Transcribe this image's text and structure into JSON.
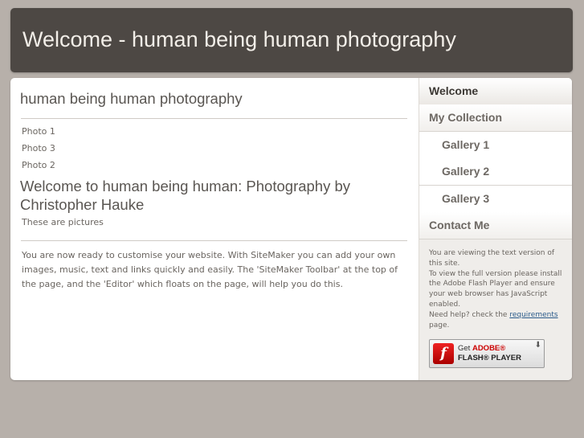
{
  "header": {
    "title": "Welcome - human being human photography"
  },
  "main": {
    "site_title": "human being human photography",
    "photos": [
      "Photo 1",
      "Photo 3",
      "Photo 2"
    ],
    "heading": "Welcome to human being human: Photography by Christopher Hauke",
    "subtitle": "These are pictures",
    "body": "You are now ready to customise your website. With SiteMaker you can add your own images, music, text and links quickly and easily. The 'SiteMaker Toolbar' at the top of the page, and the 'Editor' which floats on the page, will help you do this."
  },
  "nav": {
    "items": [
      {
        "label": "Welcome"
      },
      {
        "label": "My Collection"
      },
      {
        "label": "Gallery 1"
      },
      {
        "label": "Gallery 2"
      },
      {
        "label": "Gallery 3"
      },
      {
        "label": "Contact Me"
      }
    ]
  },
  "flash": {
    "line1": "You are viewing the text version of this site.",
    "line2": "To view the full version please install the Adobe Flash Player and ensure your web browser has JavaScript enabled.",
    "help_prefix": "Need help? check the ",
    "help_link": "requirements",
    "help_suffix": " page.",
    "badge_get": "Get ",
    "badge_adobe": "ADOBE®",
    "badge_player": "FLASH® PLAYER",
    "logo_glyph": "f"
  },
  "colors": {
    "header_bg": "#4d4844",
    "page_bg": "#b7b0aa",
    "link": "#2a5a8a"
  }
}
